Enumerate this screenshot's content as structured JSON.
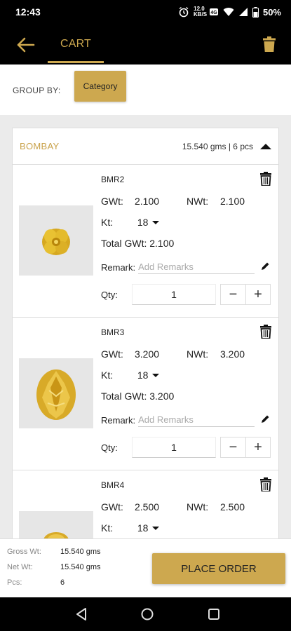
{
  "status_bar": {
    "time": "12:43",
    "data_speed_top": "12.0",
    "data_speed_unit": "KB/S",
    "network": "4G",
    "battery": "50%",
    "icons": [
      "alarm-icon",
      "volte-icon",
      "wifi-icon",
      "signal-icon",
      "battery-icon"
    ]
  },
  "app_bar": {
    "title": "CART",
    "accent": "#cda84f",
    "icons": [
      "back-arrow-icon",
      "trash-icon"
    ]
  },
  "group_by": {
    "label": "GROUP BY:",
    "button": "Category"
  },
  "group": {
    "name": "BOMBAY",
    "summary": "15.540 gms | 6 pcs",
    "items": [
      {
        "code": "BMR2",
        "gwt_label": "GWt:",
        "gwt": "2.100",
        "nwt_label": "NWt:",
        "nwt": "2.100",
        "kt_label": "Kt:",
        "kt": "18",
        "total_gwt": "Total GWt: 2.100",
        "remark_label": "Remark:",
        "remark_placeholder": "Add Remarks",
        "qty_label": "Qty:",
        "qty": "1"
      },
      {
        "code": "BMR3",
        "gwt_label": "GWt:",
        "gwt": "3.200",
        "nwt_label": "NWt:",
        "nwt": "3.200",
        "kt_label": "Kt:",
        "kt": "18",
        "total_gwt": "Total GWt: 3.200",
        "remark_label": "Remark:",
        "remark_placeholder": "Add Remarks",
        "qty_label": "Qty:",
        "qty": "1"
      },
      {
        "code": "BMR4",
        "gwt_label": "GWt:",
        "gwt": "2.500",
        "nwt_label": "NWt:",
        "nwt": "2.500",
        "kt_label": "Kt:",
        "kt": "18"
      }
    ]
  },
  "footer": {
    "gross_label": "Gross Wt:",
    "gross": "15.540 gms",
    "net_label": "Net Wt:",
    "net": "15.540 gms",
    "pcs_label": "Pcs:",
    "pcs": "6",
    "place_order": "PLACE ORDER"
  },
  "nav_bar": {
    "icons": [
      "back-triangle-icon",
      "home-circle-icon",
      "recents-square-icon"
    ]
  }
}
